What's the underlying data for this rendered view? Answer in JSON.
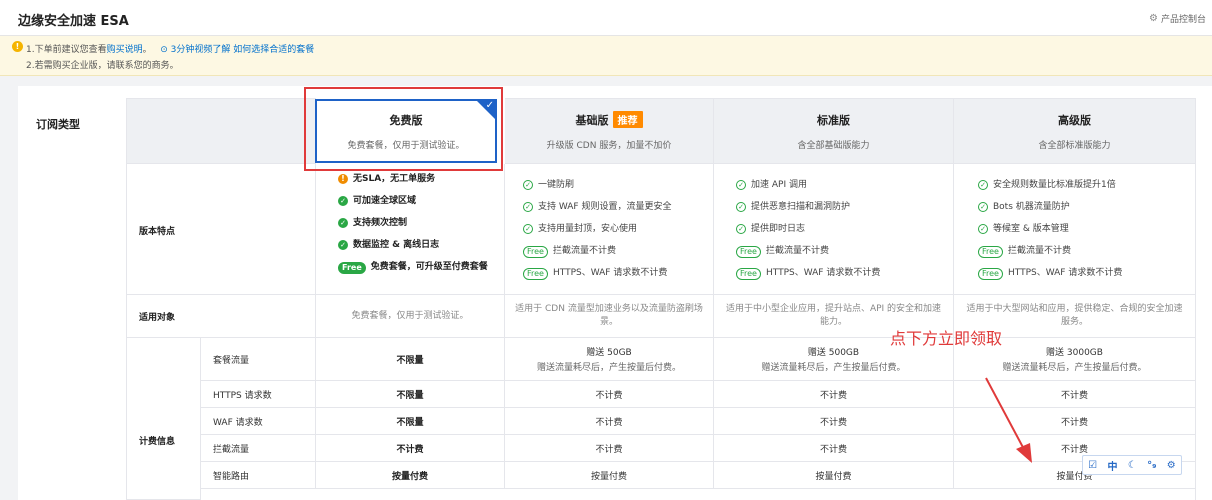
{
  "header": {
    "title": "边缘安全加速 ESA",
    "console_link": "产品控制台"
  },
  "notice": {
    "line1_prefix": "1.下单前建议您查看",
    "line1_link1": "购买说明",
    "line1_sep": "。",
    "line1_video": "3分钟视频了解",
    "line1_link2": "如何选择合适的套餐",
    "line2": "2.若需购买企业版，请联系您的商务。"
  },
  "subscription_label": "订阅类型",
  "plans": [
    {
      "name": "免费版",
      "desc": "免费套餐，仅用于测试验证。",
      "selected": true
    },
    {
      "name": "基础版",
      "badge": "推荐",
      "desc": "升级版 CDN 服务，加量不加价"
    },
    {
      "name": "标准版",
      "desc": "含全部基础版能力"
    },
    {
      "name": "高级版",
      "desc": "含全部标准版能力"
    }
  ],
  "rows": {
    "features_label": "版本特点",
    "audience_label": "适用对象",
    "billing_label": "计费信息"
  },
  "features": {
    "free": [
      {
        "icon": "warn",
        "text": "无SLA，无工单服务"
      },
      {
        "icon": "check-solid",
        "text": "可加速全球区域"
      },
      {
        "icon": "check-solid",
        "text": "支持频次控制"
      },
      {
        "icon": "check-solid",
        "text": "数据监控 & 离线日志"
      },
      {
        "icon": "free-solid",
        "pill": "Free",
        "text": "免费套餐，可升级至付费套餐"
      }
    ],
    "basic": [
      {
        "icon": "check",
        "text": "一键防刷"
      },
      {
        "icon": "check",
        "text": "支持 WAF 规则设置，流量更安全"
      },
      {
        "icon": "check",
        "text": "支持用量封顶，安心使用"
      },
      {
        "icon": "free",
        "pill": "Free",
        "text": "拦截流量不计费"
      },
      {
        "icon": "free",
        "pill": "Free",
        "text": "HTTPS、WAF 请求数不计费"
      }
    ],
    "standard": [
      {
        "icon": "check",
        "text": "加速 API 调用"
      },
      {
        "icon": "check",
        "text": "提供恶意扫描和漏洞防护"
      },
      {
        "icon": "check",
        "text": "提供即时日志"
      },
      {
        "icon": "free",
        "pill": "Free",
        "text": "拦截流量不计费"
      },
      {
        "icon": "free",
        "pill": "Free",
        "text": "HTTPS、WAF 请求数不计费"
      }
    ],
    "premium": [
      {
        "icon": "check",
        "text": "安全规则数量比标准版提升1倍"
      },
      {
        "icon": "check",
        "text": "Bots 机器流量防护"
      },
      {
        "icon": "check",
        "text": "等候室 & 版本管理"
      },
      {
        "icon": "free",
        "pill": "Free",
        "text": "拦截流量不计费"
      },
      {
        "icon": "free",
        "pill": "Free",
        "text": "HTTPS、WAF 请求数不计费"
      }
    ]
  },
  "audience": [
    "免费套餐，仅用于测试验证。",
    "适用于 CDN 流量型加速业务以及流量防盗刷场景。",
    "适用于中小型企业应用，提升站点、API 的安全和加速能力。",
    "适用于中大型网站和应用，提供稳定、合规的安全加速服务。"
  ],
  "billing": [
    {
      "label": "套餐流量",
      "values": [
        {
          "main": "不限量",
          "bold": true
        },
        {
          "main": "赠送 50GB",
          "sub": "赠送流量耗尽后，产生按量后付费。"
        },
        {
          "main": "赠送 500GB",
          "sub": "赠送流量耗尽后，产生按量后付费。"
        },
        {
          "main": "赠送 3000GB",
          "sub": "赠送流量耗尽后，产生按量后付费。"
        }
      ]
    },
    {
      "label": "HTTPS 请求数",
      "values": [
        {
          "main": "不限量",
          "bold": true
        },
        {
          "main": "不计费"
        },
        {
          "main": "不计费"
        },
        {
          "main": "不计费"
        }
      ]
    },
    {
      "label": "WAF 请求数",
      "values": [
        {
          "main": "不限量",
          "bold": true
        },
        {
          "main": "不计费"
        },
        {
          "main": "不计费"
        },
        {
          "main": "不计费"
        }
      ]
    },
    {
      "label": "拦截流量",
      "values": [
        {
          "main": "不计费",
          "bold": true
        },
        {
          "main": "不计费"
        },
        {
          "main": "不计费"
        },
        {
          "main": "不计费"
        }
      ]
    },
    {
      "label": "智能路由",
      "values": [
        {
          "main": "按量付费",
          "bold": true
        },
        {
          "main": "按量付费"
        },
        {
          "main": "按量付费"
        },
        {
          "main": "按量付费"
        }
      ]
    }
  ],
  "annotation": "点下方立即领取",
  "toolbar": {
    "items": [
      "☑",
      "中",
      "☾",
      "°₉",
      "⚙"
    ]
  },
  "colors": {
    "accent": "#1e62c7",
    "badge": "#ff8a00",
    "check": "#2aa745",
    "annotation": "#e03a3a",
    "notice_bg": "#fdf8e3"
  }
}
